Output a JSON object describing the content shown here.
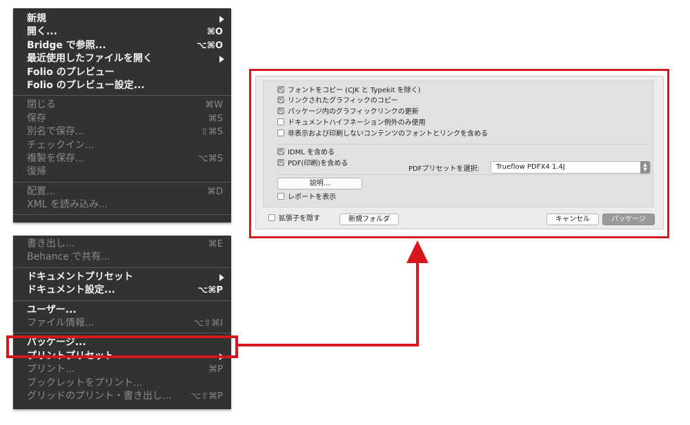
{
  "file_menu_top": {
    "items": [
      {
        "label": "新規",
        "shortcut": "",
        "submenu": true,
        "disabled": false
      },
      {
        "label": "開く...",
        "shortcut": "⌘O",
        "submenu": false,
        "disabled": false
      },
      {
        "label": "Bridge で参照...",
        "shortcut": "⌥⌘O",
        "submenu": false,
        "disabled": false
      },
      {
        "label": "最近使用したファイルを開く",
        "shortcut": "",
        "submenu": true,
        "disabled": false
      },
      {
        "label": "Folio のプレビュー",
        "shortcut": "",
        "submenu": false,
        "disabled": false
      },
      {
        "label": "Folio のプレビュー設定...",
        "shortcut": "",
        "submenu": false,
        "disabled": false
      },
      {
        "label": "閉じる",
        "shortcut": "⌘W",
        "submenu": false,
        "disabled": true
      },
      {
        "label": "保存",
        "shortcut": "⌘S",
        "submenu": false,
        "disabled": true
      },
      {
        "label": "別名で保存...",
        "shortcut": "⇧⌘S",
        "submenu": false,
        "disabled": true
      },
      {
        "label": "チェックイン...",
        "shortcut": "",
        "submenu": false,
        "disabled": true
      },
      {
        "label": "複製を保存...",
        "shortcut": "⌥⌘S",
        "submenu": false,
        "disabled": true
      },
      {
        "label": "復帰",
        "shortcut": "",
        "submenu": false,
        "disabled": true
      },
      {
        "label": "配置...",
        "shortcut": "⌘D",
        "submenu": false,
        "disabled": true
      },
      {
        "label": "XML を読み込み...",
        "shortcut": "",
        "submenu": false,
        "disabled": true
      }
    ]
  },
  "file_menu_bottom": {
    "items": [
      {
        "label": "書き出し...",
        "shortcut": "⌘E",
        "submenu": false,
        "disabled": true
      },
      {
        "label": "Behance で共有...",
        "shortcut": "",
        "submenu": false,
        "disabled": true
      },
      {
        "label": "ドキュメントプリセット",
        "shortcut": "",
        "submenu": true,
        "disabled": false
      },
      {
        "label": "ドキュメント設定...",
        "shortcut": "⌥⌘P",
        "submenu": false,
        "disabled": false
      },
      {
        "label": "ユーザー...",
        "shortcut": "",
        "submenu": false,
        "disabled": false
      },
      {
        "label": "ファイル情報...",
        "shortcut": "⌥⇧⌘I",
        "submenu": false,
        "disabled": true
      },
      {
        "label": "パッケージ...",
        "shortcut": "",
        "submenu": false,
        "disabled": false
      },
      {
        "label": "プリントプリセット",
        "shortcut": "",
        "submenu": true,
        "disabled": false
      },
      {
        "label": "プリント...",
        "shortcut": "⌘P",
        "submenu": false,
        "disabled": true
      },
      {
        "label": "ブックレットをプリント...",
        "shortcut": "",
        "submenu": false,
        "disabled": true
      },
      {
        "label": "グリッドのプリント・書き出し...",
        "shortcut": "⌥⇧⌘P",
        "submenu": false,
        "disabled": true
      }
    ]
  },
  "dialog": {
    "options": [
      {
        "label": "フォントをコピー (CJK と Typekit を除く)",
        "checked": true
      },
      {
        "label": "リンクされたグラフィックのコピー",
        "checked": true
      },
      {
        "label": "パッケージ内のグラフィックリンクの更新",
        "checked": true
      },
      {
        "label": "ドキュメントハイフネーション例外のみ使用",
        "checked": false
      },
      {
        "label": "非表示および印刷しないコンテンツのフォントとリンクを含める",
        "checked": false
      }
    ],
    "idml": {
      "label": "IDML を含める",
      "checked": true
    },
    "pdf": {
      "label": "PDF(印刷)を含める",
      "checked": true
    },
    "preset_label": "PDFプリセットを選択:",
    "preset_value": "Trueflow PDFX4 1.4J",
    "instructions_button": "説明...",
    "show_report": {
      "label": "レポートを表示",
      "checked": false
    },
    "hide_extension": {
      "label": "拡張子を隠す",
      "checked": false
    },
    "new_folder_button": "新規フォルダ",
    "cancel_button": "キャンセル",
    "package_button": "パッケージ"
  },
  "colors": {
    "menu_bg": "#323232",
    "highlight_red": "#d7161e",
    "dialog_bg": "#ececec"
  }
}
